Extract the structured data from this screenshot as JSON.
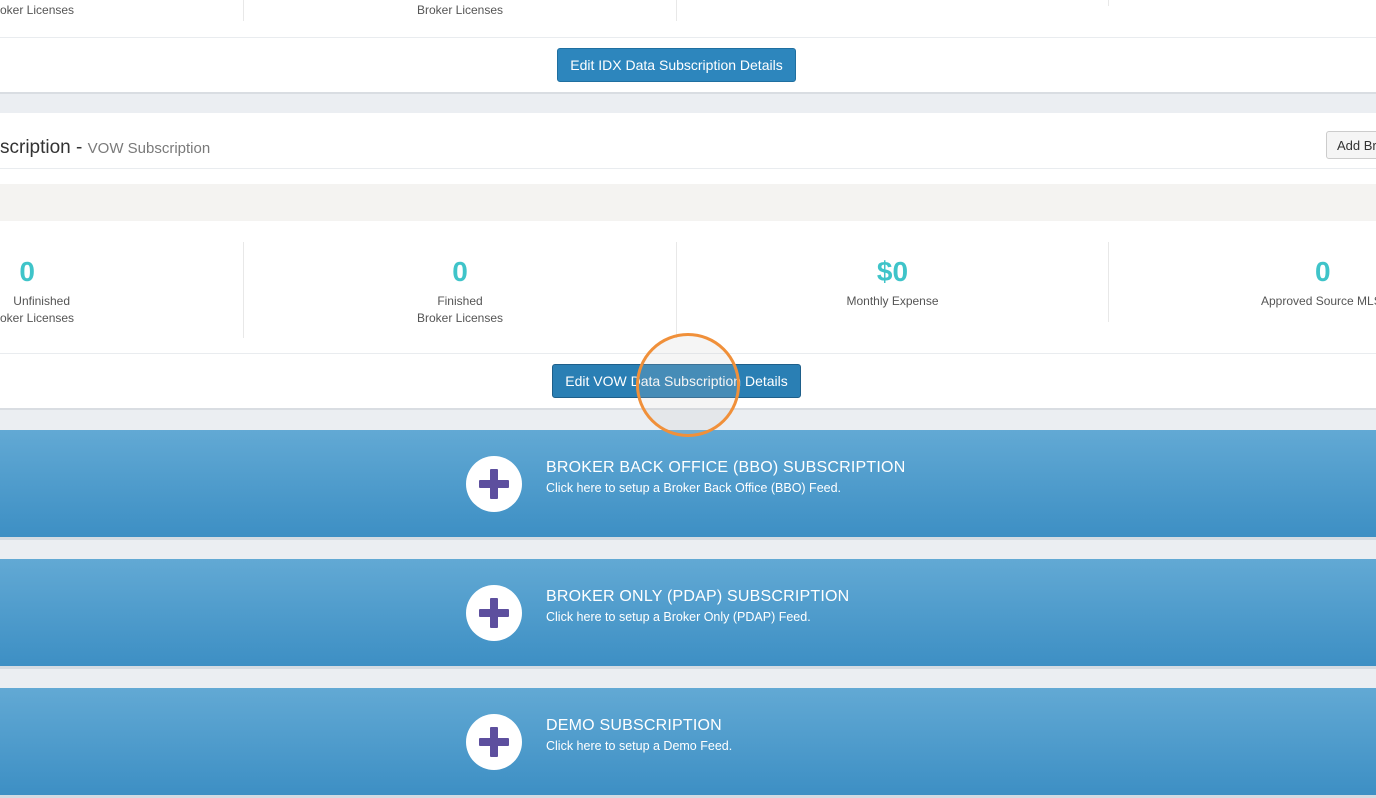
{
  "idx_panel": {
    "col1_label": "oker Licenses",
    "col2_label": "Broker Licenses",
    "edit_button": "Edit IDX Data Subscription Details"
  },
  "vow_panel": {
    "title": "scription - ",
    "subtitle": "VOW Subscription",
    "add_button": "Add Br",
    "stats": [
      {
        "value": "0",
        "label_line1": "Unfinished",
        "label_line2": "oker Licenses"
      },
      {
        "value": "0",
        "label_line1": "Finished",
        "label_line2": "Broker Licenses"
      },
      {
        "value": "$0",
        "label_line1": "Monthly Expense",
        "label_line2": ""
      },
      {
        "value": "0",
        "label_line1": "Approved Source MLS",
        "label_line2": ""
      }
    ],
    "edit_button": "Edit VOW Data Subscription Details"
  },
  "feeds": [
    {
      "title": "BROKER BACK OFFICE (BBO) SUBSCRIPTION",
      "description": "Click here to setup a Broker Back Office (BBO) Feed.",
      "icon": "plus-icon"
    },
    {
      "title": "BROKER ONLY (PDAP) SUBSCRIPTION",
      "description": "Click here to setup a Broker Only (PDAP) Feed.",
      "icon": "plus-icon"
    },
    {
      "title": "DEMO SUBSCRIPTION",
      "description": "Click here to setup a Demo Feed.",
      "icon": "plus-icon"
    }
  ],
  "colors": {
    "accent": "#2d86bd",
    "stat_number": "#3fc4c9",
    "plus_icon": "#5d4f9e",
    "click_marker": "#f0903a"
  }
}
